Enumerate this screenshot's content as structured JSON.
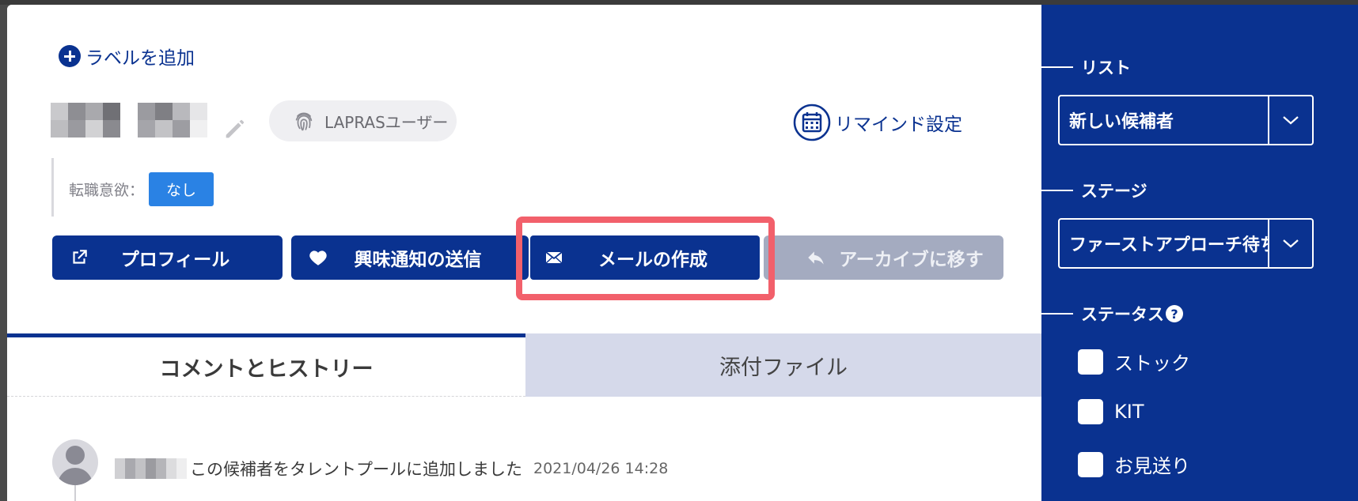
{
  "header": {
    "add_label": "ラベルを追加",
    "lapras_chip": "LAPRASユーザー",
    "remind": "リマインド設定",
    "intent_label": "転職意欲：",
    "intent_value": "なし"
  },
  "actions": {
    "profile": "プロフィール",
    "interest": "興味通知の送信",
    "mail": "メールの作成",
    "archive": "アーカイブに移す"
  },
  "tabs": [
    {
      "label": "コメントとヒストリー",
      "active": true
    },
    {
      "label": "添付ファイル",
      "active": false
    }
  ],
  "history": {
    "text": "この候補者をタレントプールに追加しました",
    "time": "2021/04/26 14:28"
  },
  "sidebar": {
    "list_heading": "リスト",
    "list_value": "新しい候補者",
    "stage_heading": "ステージ",
    "stage_value": "ファーストアプローチ待ち",
    "status_heading": "ステータス",
    "status_options": [
      {
        "label": "ストック",
        "checked": false
      },
      {
        "label": "KIT",
        "checked": false
      },
      {
        "label": "お見送り",
        "checked": false
      }
    ]
  },
  "colors": {
    "brand": "#0a3290",
    "highlight": "#f2606b",
    "badge": "#2a82e4",
    "disabled_button": "#a4abc0"
  }
}
